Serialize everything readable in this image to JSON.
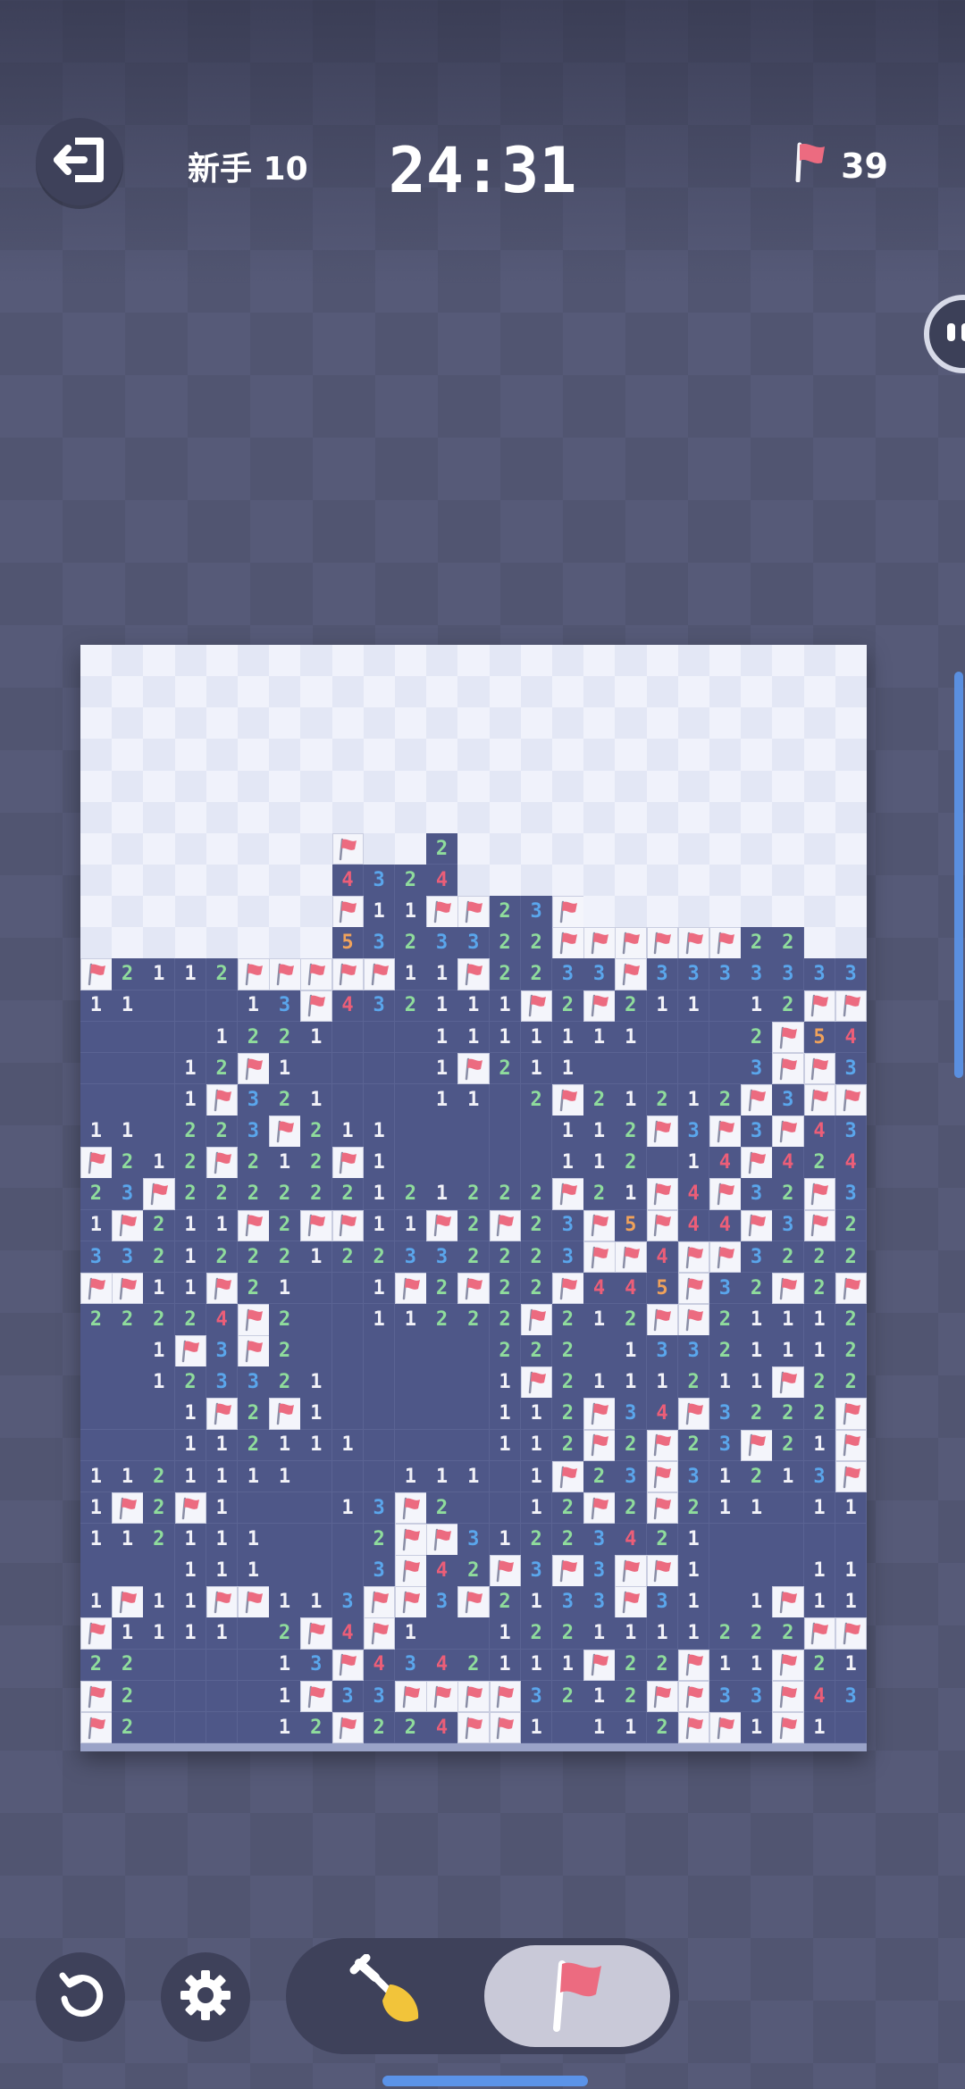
{
  "header": {
    "exit_icon": "exit-icon",
    "level_label": "新手 10",
    "timer": "24:31",
    "flag_icon": "flag-icon",
    "flags_remaining": "39"
  },
  "colors": {
    "accent_blue": "#5aa6ec",
    "flag_red": "#ec6b80",
    "number_1": "#f2f2f8",
    "number_2": "#8fdc9c",
    "number_3": "#5aa6ec",
    "number_4": "#ec5e78",
    "number_5": "#f0a25a"
  },
  "board": {
    "cols": 25,
    "rows": 35,
    "legend": ". = covered, F = flag, _ = empty opened, digit = count",
    "grid": [
      ".........................",
      ".........................",
      ".........................",
      ".........................",
      ".........................",
      ".........................",
      "........F..2.............",
      "........4324.............",
      "........F11FF23F.........",
      "........5323322FFFFFF22..",
      "F2112FFFFF11F2233F3333333",
      "11___13F432111F2F211_12FF4",
      "____1221___1111111___2F54FF",
      "___12F1____1F211_____3FF333",
      "___1F321___11_2F21212F3FF21F",
      "11_223F211_____112F3F3F4321_11",
      "F212F212F1_____112_14F424F2_",
      "23F222222121222F21F4F32F3F11",
      "1F211F2FF11F2F23F5F44F3F2F2",
      "3321222122332223FF4FF32222F",
      "FF11F21__1F2F22F445F32F2F33",
      "22224F2__11222F212FF21112FF",
      "__1F3F2______222_133211122",
      "__123321_____1F2111211F222",
      "___1F2F1_____112F34F3222FF2",
      "___112111____112F2F23F21F3F3",
      "1121111___111_1F23F31213FF23F",
      "1F2F1___13F2__12F2F211_111_1F3",
      "112111___2FF31223421______1F2F",
      "___111___3F42F3F3FF1___111___122",
      "1F11FF113FF3F2133F31_1F11112F21",
      "F1111_2F4F1__1221111222FF21F11",
      "22____13F4342111F22F11F21F211",
      "F2____1F33FFFF3212FF33F432_2F2",
      "F2____12F224FF1_112FF1F1___2F2"
    ]
  },
  "toolbar": {
    "undo_icon": "undo-icon",
    "settings_icon": "gear-icon",
    "dig_tool_icon": "shovel-icon",
    "flag_tool_icon": "flag-icon",
    "active_tool": "flag"
  }
}
